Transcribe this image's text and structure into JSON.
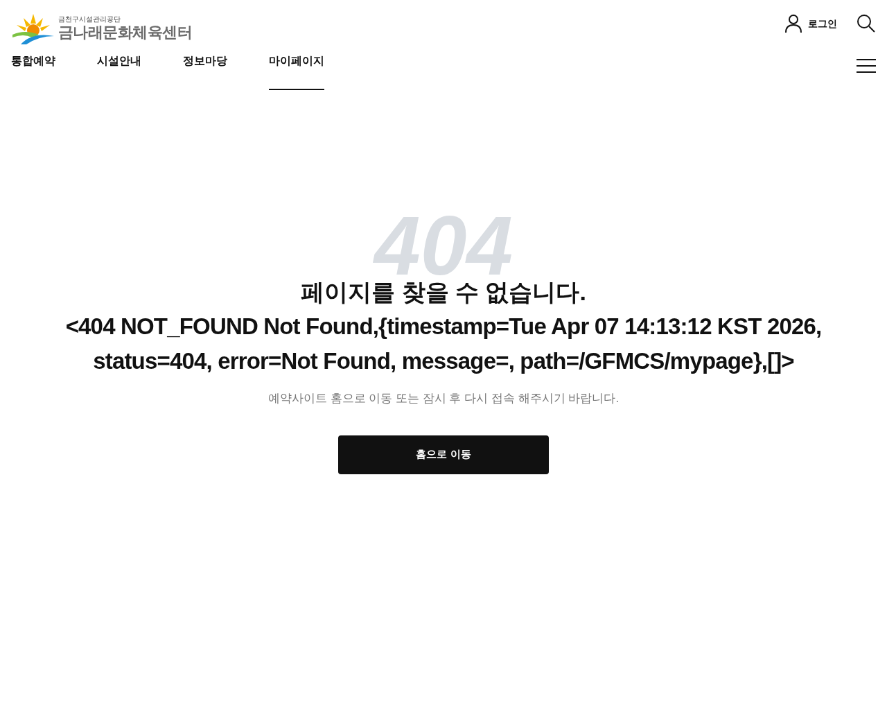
{
  "header": {
    "logo_subtitle": "금천구시설관리공단",
    "logo_title": "금나래문화체육센터",
    "login": "로그인"
  },
  "nav": [
    {
      "label": "통합예약",
      "selected": false
    },
    {
      "label": "시설안내",
      "selected": false
    },
    {
      "label": "정보마당",
      "selected": false
    },
    {
      "label": "마이페이지",
      "selected": true
    }
  ],
  "error": {
    "code": "404",
    "title": "페이지를 찾을 수 없습니다.",
    "message": "<404 NOT_FOUND Not Found,{timestamp=Tue Apr 07 14:13:12 KST 2026, status=404, error=Not Found, message=, path=/GFMCS/mypage},[]>",
    "hint": "예약사이트 홈으로 이동 또는 잠시 후 다시 접속 해주시기 바랍니다.",
    "button": "홈으로 이동"
  }
}
